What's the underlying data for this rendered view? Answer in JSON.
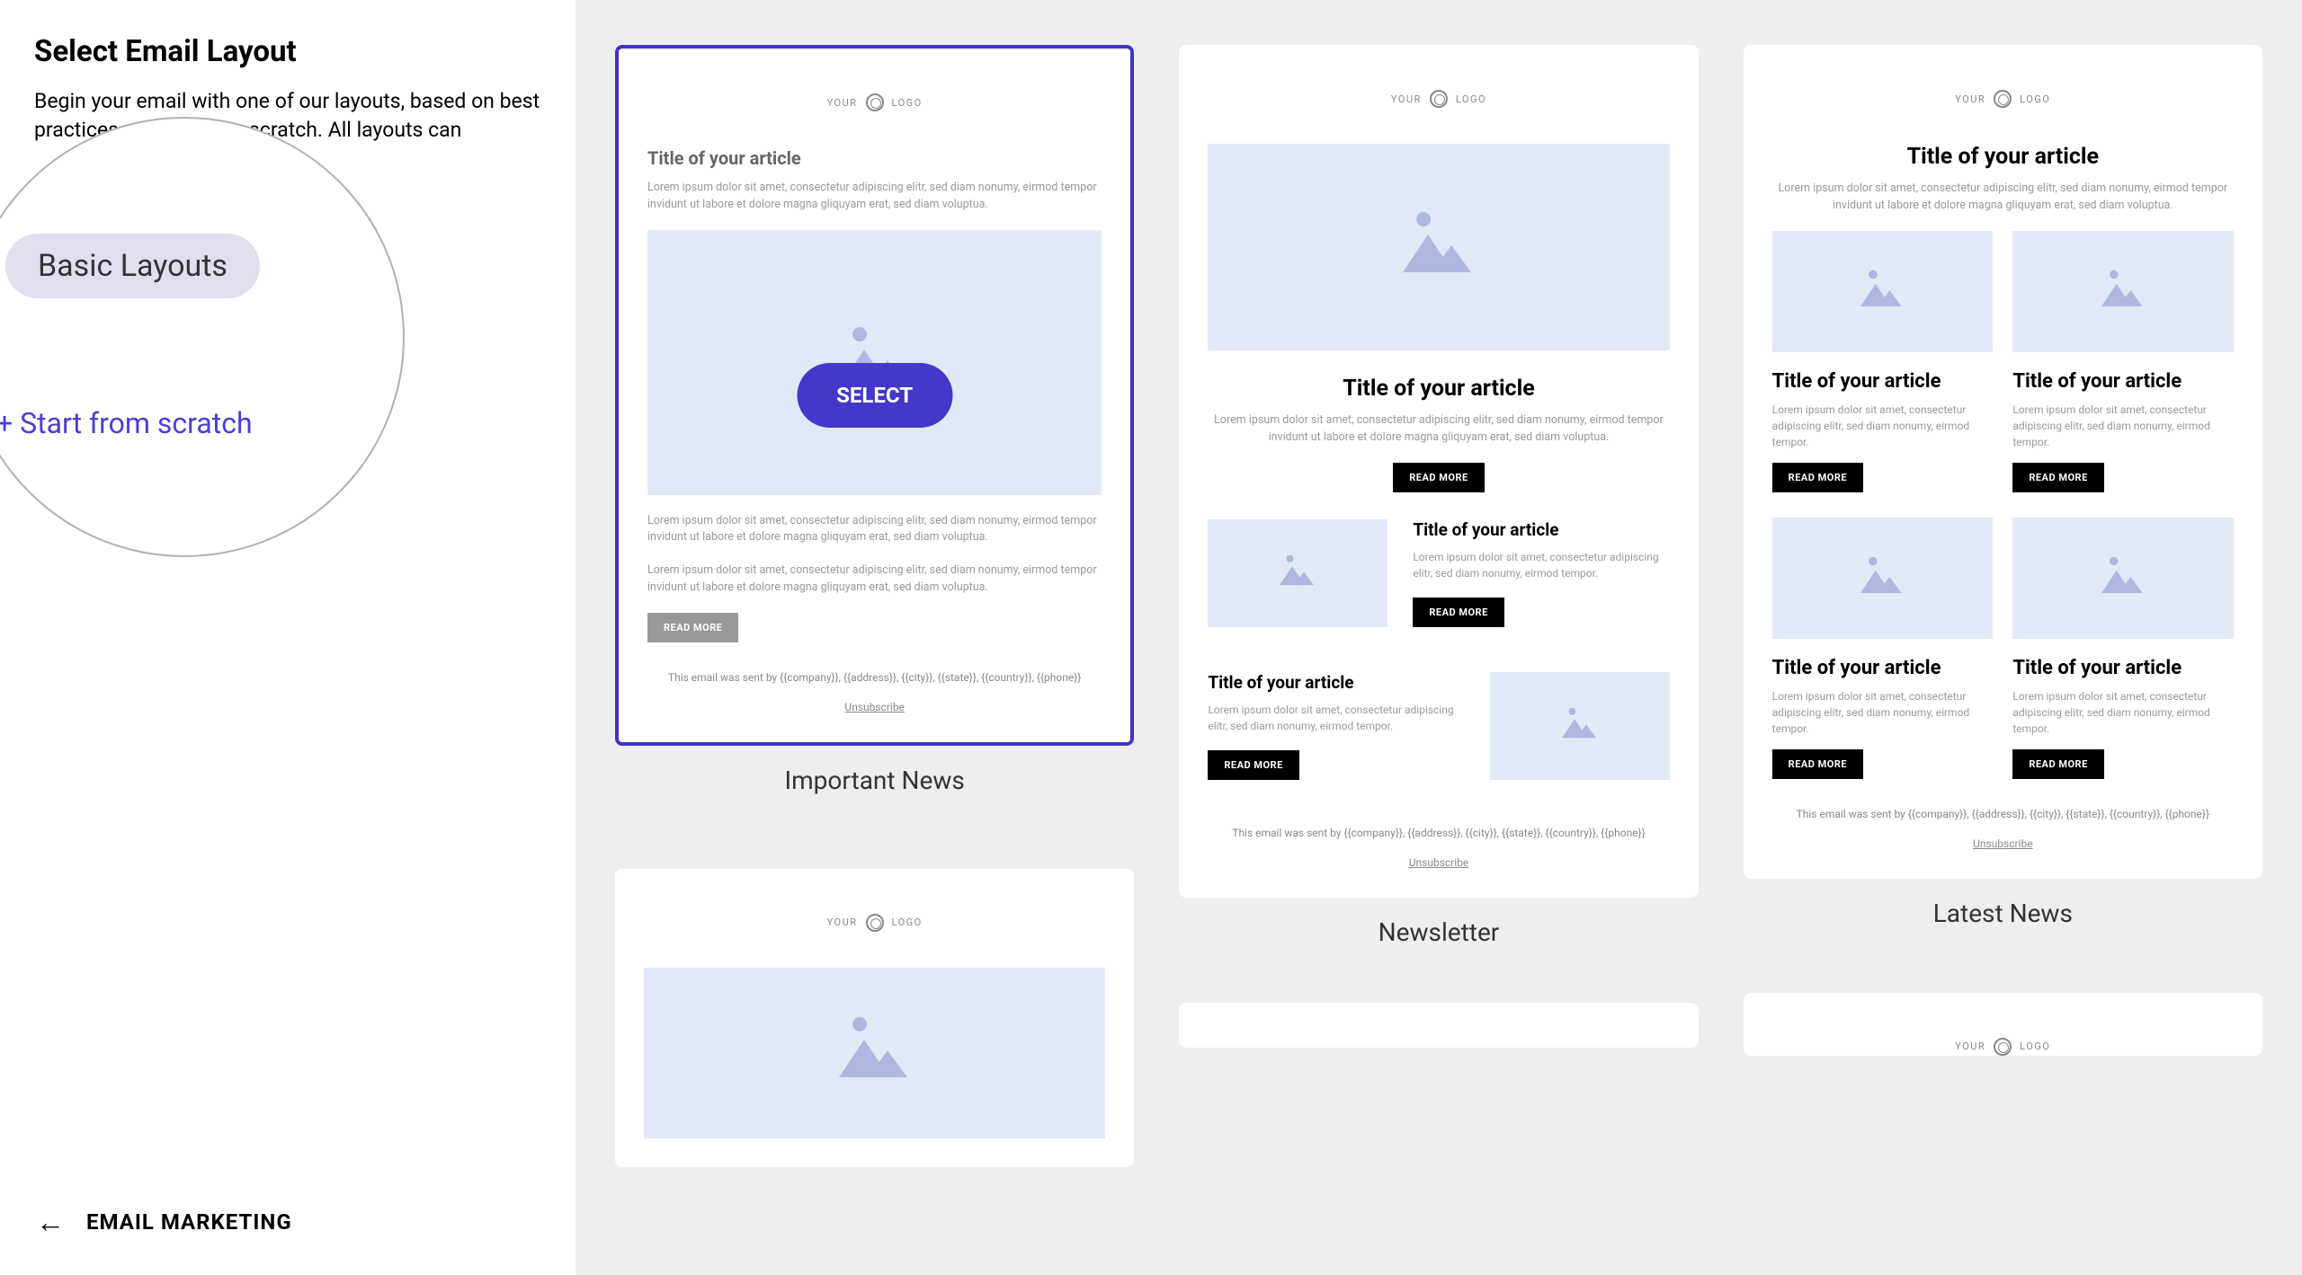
{
  "sidebar": {
    "title": "Select Email Layout",
    "description": "Begin your email with one of our layouts, based on best practices, or start from scratch. All layouts can",
    "basic_layouts_label": "Basic Layouts",
    "start_scratch_label": "+ Start from scratch",
    "footer_label": "EMAIL MARKETING"
  },
  "logo": {
    "left": "YOUR",
    "right": "LOGO"
  },
  "common": {
    "article_title": "Title of your article",
    "lorem": "Lorem ipsum dolor sit amet, consectetur adipiscing elitr, sed diam nonumy, eirmod tempor invidunt ut labore et dolore magna gliquyam erat, sed diam voluptua.",
    "lorem_short": "Lorem ipsum dolor sit amet, consectetur adipiscing elitr, sed diam nonumy, eirmod tempor.",
    "read_more": "READ MORE",
    "select": "SELECT",
    "sent_by": "This email was sent by {{company}}, {{address}}, {{city}}, {{state}}, {{country}}, {{phone}}",
    "unsubscribe": "Unsubscribe"
  },
  "layouts": {
    "important_news": "Important News",
    "newsletter": "Newsletter",
    "latest_news": "Latest News"
  }
}
